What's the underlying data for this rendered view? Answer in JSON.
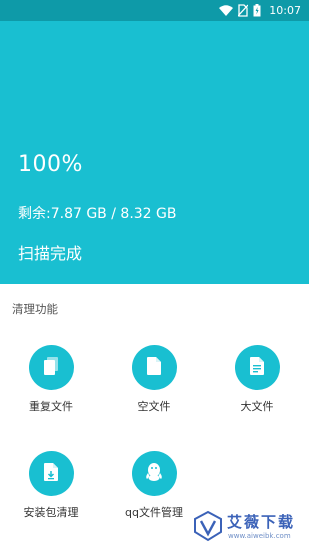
{
  "status_bar": {
    "time": "10:07",
    "icons": [
      "wifi-icon",
      "no-sim-icon",
      "battery-icon"
    ],
    "background": "#0e9aa8"
  },
  "hero": {
    "percent": "100%",
    "storage": "剩余:7.87 GB / 8.32 GB",
    "status": "扫描完成",
    "background": "#19bfd1"
  },
  "section": {
    "title": "清理功能"
  },
  "features": [
    {
      "label": "重复文件",
      "icon": "duplicate-files-icon"
    },
    {
      "label": "空文件",
      "icon": "empty-file-icon"
    },
    {
      "label": "大文件",
      "icon": "large-file-icon"
    },
    {
      "label": "安装包清理",
      "icon": "apk-file-icon"
    },
    {
      "label": "qq文件管理",
      "icon": "qq-icon"
    }
  ],
  "watermark": {
    "title": "艾薇下载",
    "url": "www.aiweibk.com"
  }
}
